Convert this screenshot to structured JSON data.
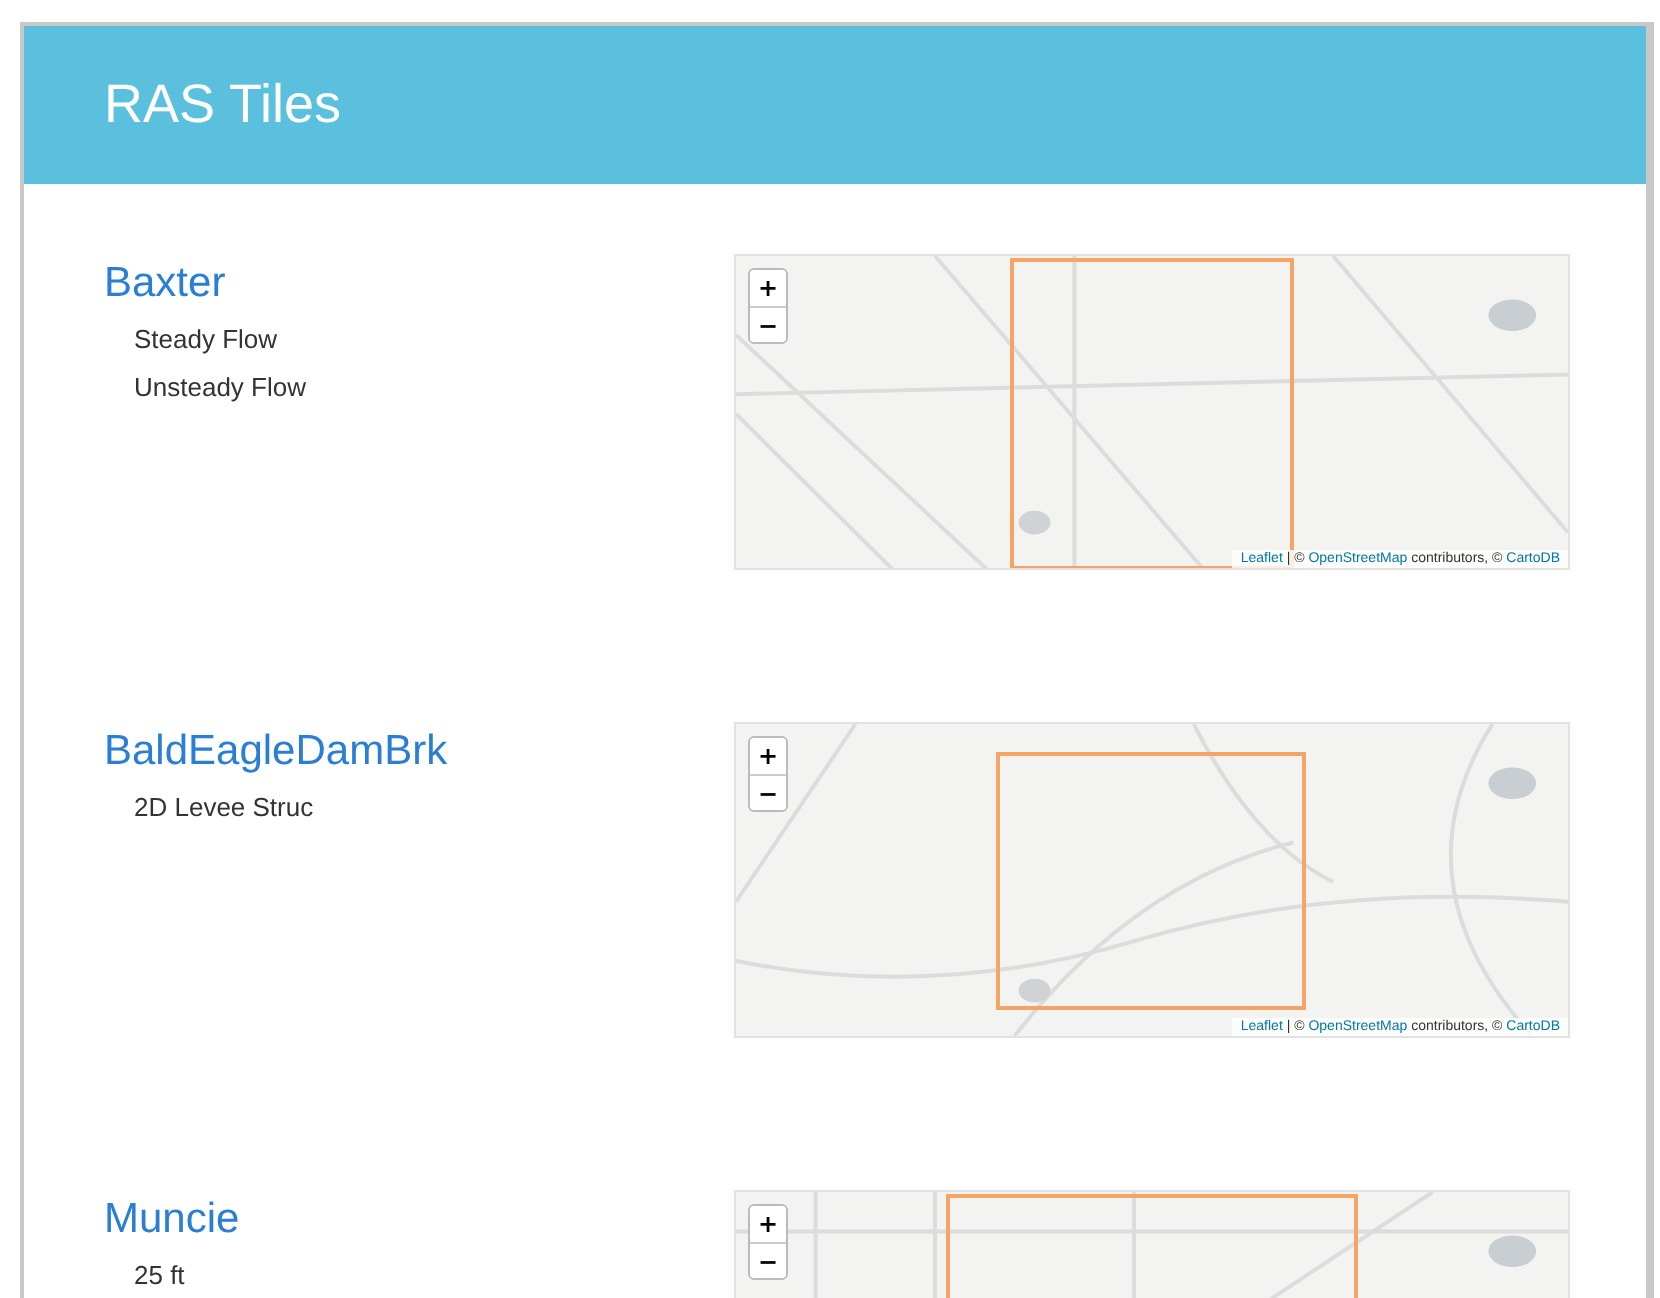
{
  "header": {
    "title": "RAS Tiles"
  },
  "projects": [
    {
      "name": "Baxter",
      "plans": [
        "Steady Flow",
        "Unsteady Flow"
      ],
      "map": {
        "zoom_in": "+",
        "zoom_out": "−",
        "attribution": [
          {
            "kind": "link",
            "text": "Leaflet"
          },
          {
            "kind": "text",
            "text": " | © "
          },
          {
            "kind": "link",
            "text": "OpenStreetMap"
          },
          {
            "kind": "text",
            "text": " contributors, © "
          },
          {
            "kind": "link",
            "text": "CartoDB"
          }
        ]
      }
    },
    {
      "name": "BaldEagleDamBrk",
      "plans": [
        "2D Levee Struc"
      ],
      "map": {
        "zoom_in": "+",
        "zoom_out": "−",
        "attribution": [
          {
            "kind": "link",
            "text": "Leaflet"
          },
          {
            "kind": "text",
            "text": " | © "
          },
          {
            "kind": "link",
            "text": "OpenStreetMap"
          },
          {
            "kind": "text",
            "text": " contributors, © "
          },
          {
            "kind": "link",
            "text": "CartoDB"
          }
        ]
      }
    },
    {
      "name": "Muncie",
      "plans": [
        "25 ft"
      ],
      "map": {
        "zoom_in": "+",
        "zoom_out": "−"
      }
    }
  ]
}
